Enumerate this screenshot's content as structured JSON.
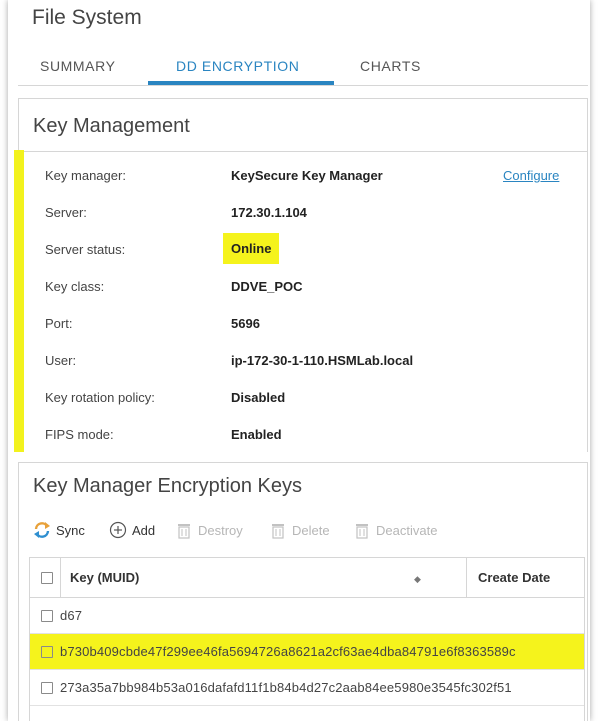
{
  "page": {
    "title": "File System"
  },
  "tabs": [
    {
      "label": "SUMMARY"
    },
    {
      "label": "DD ENCRYPTION"
    },
    {
      "label": "CHARTS"
    }
  ],
  "key_management": {
    "title": "Key Management",
    "rows": [
      {
        "label": "Key manager:",
        "value": "KeySecure Key Manager",
        "link": "Configure"
      },
      {
        "label": "Server:",
        "value": "172.30.1.104"
      },
      {
        "label": "Server status:",
        "value": "Online"
      },
      {
        "label": "Key class:",
        "value": "DDVE_POC"
      },
      {
        "label": "Port:",
        "value": "5696"
      },
      {
        "label": "User:",
        "value": "ip-172-30-1-110.HSMLab.local"
      },
      {
        "label": "Key rotation policy:",
        "value": "Disabled"
      },
      {
        "label": "FIPS mode:",
        "value": "Enabled"
      }
    ]
  },
  "encryption_keys": {
    "title": "Key Manager Encryption Keys",
    "toolbar": {
      "sync": "Sync",
      "add": "Add",
      "destroy": "Destroy",
      "delete": "Delete",
      "deactivate": "Deactivate"
    },
    "columns": {
      "key": "Key (MUID)",
      "create_date": "Create Date"
    },
    "rows": [
      {
        "key": "d67"
      },
      {
        "key": "b730b409cbde47f299ee46fa5694726a8621a2cf63ae4dba84791e6f8363589c"
      },
      {
        "key": "273a35a7bb984b53a016dafafd11f1b84b4d27c2aab84ee5980e3545fc302f51"
      }
    ]
  },
  "colors": {
    "accent": "#2a85c1",
    "highlight": "#f5f31c"
  }
}
